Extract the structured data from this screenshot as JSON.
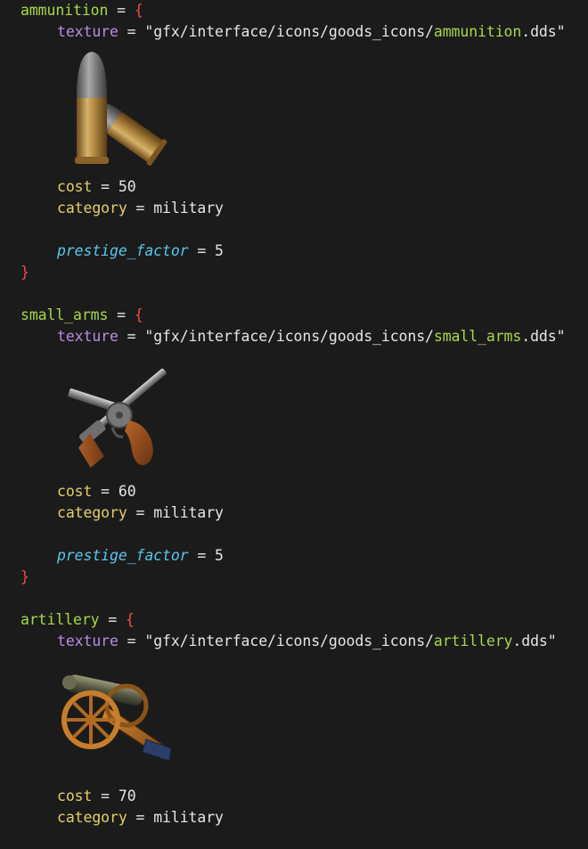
{
  "blocks": [
    {
      "name": "ammunition",
      "assign": " = ",
      "open": "{",
      "texture_key": "texture",
      "texture_assign": " = ",
      "texture_prefix": "\"gfx/interface/icons/goods_icons/",
      "texture_file": "ammunition",
      "texture_suffix": ".dds\"",
      "icon": "ammunition-icon",
      "cost_key": "cost",
      "cost_assign": " = ",
      "cost_value": "50",
      "category_key": "category",
      "category_assign": " = ",
      "category_value": "military",
      "prestige_key": "prestige_factor",
      "prestige_assign": " = ",
      "prestige_value": "5",
      "close": "}"
    },
    {
      "name": "small_arms",
      "assign": " = ",
      "open": "{",
      "texture_key": "texture",
      "texture_assign": " = ",
      "texture_prefix": "\"gfx/interface/icons/goods_icons/",
      "texture_file": "small_arms",
      "texture_suffix": ".dds\"",
      "icon": "small-arms-icon",
      "cost_key": "cost",
      "cost_assign": " = ",
      "cost_value": "60",
      "category_key": "category",
      "category_assign": " = ",
      "category_value": "military",
      "prestige_key": "prestige_factor",
      "prestige_assign": " = ",
      "prestige_value": "5",
      "close": "}"
    },
    {
      "name": "artillery",
      "assign": " = ",
      "open": "{",
      "texture_key": "texture",
      "texture_assign": " = ",
      "texture_prefix": "\"gfx/interface/icons/goods_icons/",
      "texture_file": "artillery",
      "texture_suffix": ".dds\"",
      "icon": "artillery-icon",
      "cost_key": "cost",
      "cost_assign": " = ",
      "cost_value": "70",
      "category_key": "category",
      "category_assign": " = ",
      "category_value": "military"
    }
  ],
  "colors": {
    "background": "#1b1b1b",
    "block_name": "#a6d84b",
    "property_key": "#e4cf6a",
    "texture_key": "#b88ce6",
    "italic_key": "#5cc6ea",
    "brace": "#f04a4a"
  }
}
